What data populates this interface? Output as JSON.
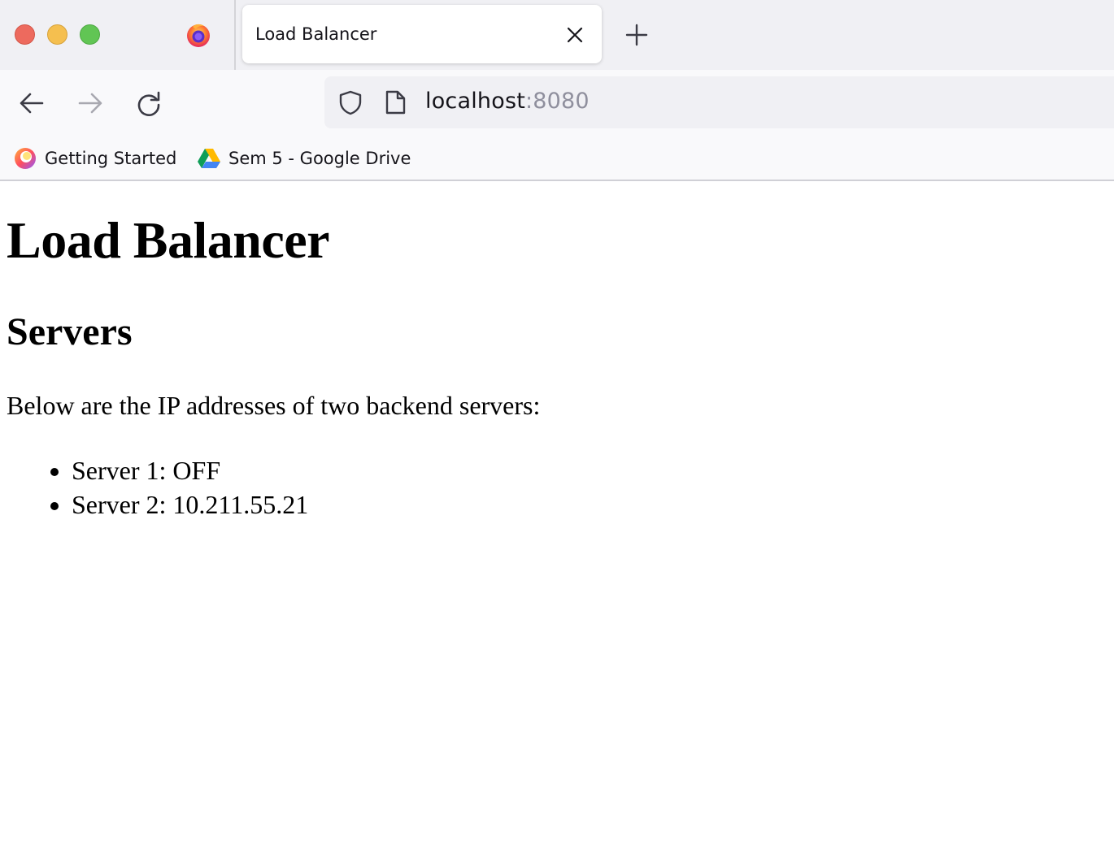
{
  "browser": {
    "tab": {
      "title": "Load Balancer"
    },
    "url": {
      "host": "localhost",
      "port": ":8080"
    },
    "bookmarks": [
      {
        "label": "Getting Started"
      },
      {
        "label": "Sem 5 - Google Drive"
      }
    ]
  },
  "page": {
    "title": "Load Balancer",
    "section_title": "Servers",
    "description": "Below are the IP addresses of two backend servers:",
    "servers": [
      "Server 1: OFF",
      "Server 2: 10.211.55.21"
    ]
  },
  "colors": {
    "close": "#ed6a5e",
    "minimize": "#f5bf4f",
    "maximize": "#61c554"
  }
}
